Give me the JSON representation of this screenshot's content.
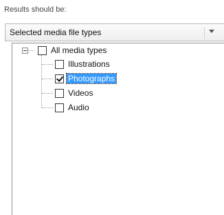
{
  "header": {
    "label": "Results should be:"
  },
  "filter": {
    "selected": "Selected media file types"
  },
  "tree": {
    "root": {
      "label": "All media types",
      "checked": false,
      "expanded": true
    },
    "children": [
      {
        "label": "Illustrations",
        "checked": false,
        "selected": false
      },
      {
        "label": "Photographs",
        "checked": true,
        "selected": true
      },
      {
        "label": "Videos",
        "checked": false,
        "selected": false
      },
      {
        "label": "Audio",
        "checked": false,
        "selected": false
      }
    ]
  },
  "colors": {
    "selection": "#3399ff",
    "border": "#8e8e8e"
  },
  "icons": {
    "expander": "collapse-minus-icon",
    "dropdown": "chevron-down-icon"
  }
}
